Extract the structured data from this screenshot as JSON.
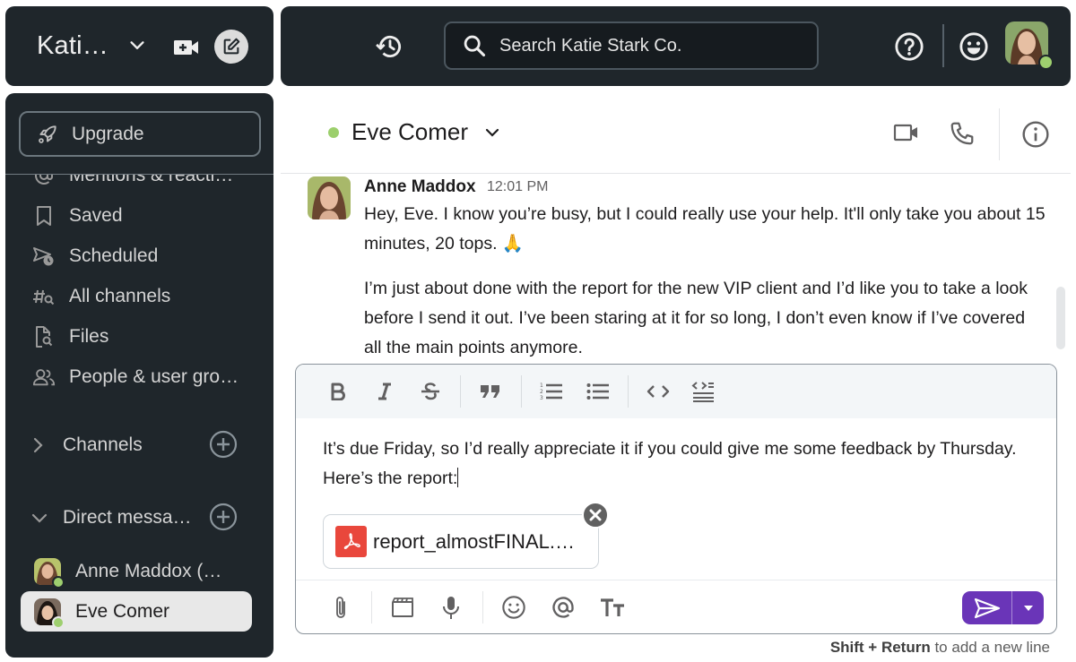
{
  "workspace": {
    "name": "Kati…",
    "icons": {
      "chevron": "chevron-down-icon",
      "video": "video-plus-icon",
      "compose": "compose-icon"
    }
  },
  "topbar": {
    "search_placeholder": "Search Katie Stark Co.",
    "search_value": "",
    "icons": [
      "history-icon",
      "search-icon",
      "help-icon",
      "smiley-icon"
    ],
    "user": {
      "avatar": "user-avatar",
      "presence": "online",
      "presence_color": "#9ecf6f"
    }
  },
  "sidebar": {
    "upgrade_label": "Upgrade",
    "nav_items": [
      {
        "label": "Mentions & reacti…",
        "icon": "at-icon"
      },
      {
        "label": "Saved",
        "icon": "bookmark-icon"
      },
      {
        "label": "Scheduled",
        "icon": "scheduled-send-icon"
      },
      {
        "label": "All channels",
        "icon": "channel-search-icon"
      },
      {
        "label": "Files",
        "icon": "file-search-icon"
      },
      {
        "label": "People & user gro…",
        "icon": "people-icon"
      }
    ],
    "channels_section": {
      "label": "Channels",
      "expanded": false
    },
    "dm_section": {
      "label": "Direct messa…",
      "expanded": true
    },
    "direct_messages": [
      {
        "name": "Anne Maddox (…",
        "presence": "online",
        "active": false
      },
      {
        "name": "Eve Comer",
        "presence": "online",
        "active": true
      }
    ]
  },
  "channel": {
    "name": "Eve Comer",
    "presence": "online",
    "presence_color": "#9ccf6c",
    "actions": [
      "video-call-icon",
      "phone-call-icon",
      "info-icon"
    ]
  },
  "messages": [
    {
      "sender": "Anne Maddox",
      "time": "12:01 PM",
      "paragraphs": [
        "Hey, Eve. I know you’re busy, but I could really use your help. It'll only take you about 15 minutes, 20 tops. 🙏",
        "I’m just about done with the report for the new VIP client and I’d like you to take a look before I send it out. I’ve been staring at it for so long, I don’t even know if I’ve covered all the main points anymore."
      ]
    }
  ],
  "composer": {
    "formatting": [
      "bold",
      "italic",
      "strikethrough",
      "quote",
      "ordered-list",
      "bulleted-list",
      "code",
      "code-block"
    ],
    "text": "It’s due Friday, so I’d really appreciate it if you could give me some feedback by Thursday. Here’s the report:",
    "attachment": {
      "filename": "report_almostFINAL.…",
      "type": "pdf"
    },
    "actions": [
      "attach",
      "video-clip",
      "audio-clip",
      "emoji",
      "mention",
      "text-format"
    ],
    "send_color": "#6a35b8",
    "hint_key": "Shift + Return",
    "hint_text": " to add a new line"
  }
}
